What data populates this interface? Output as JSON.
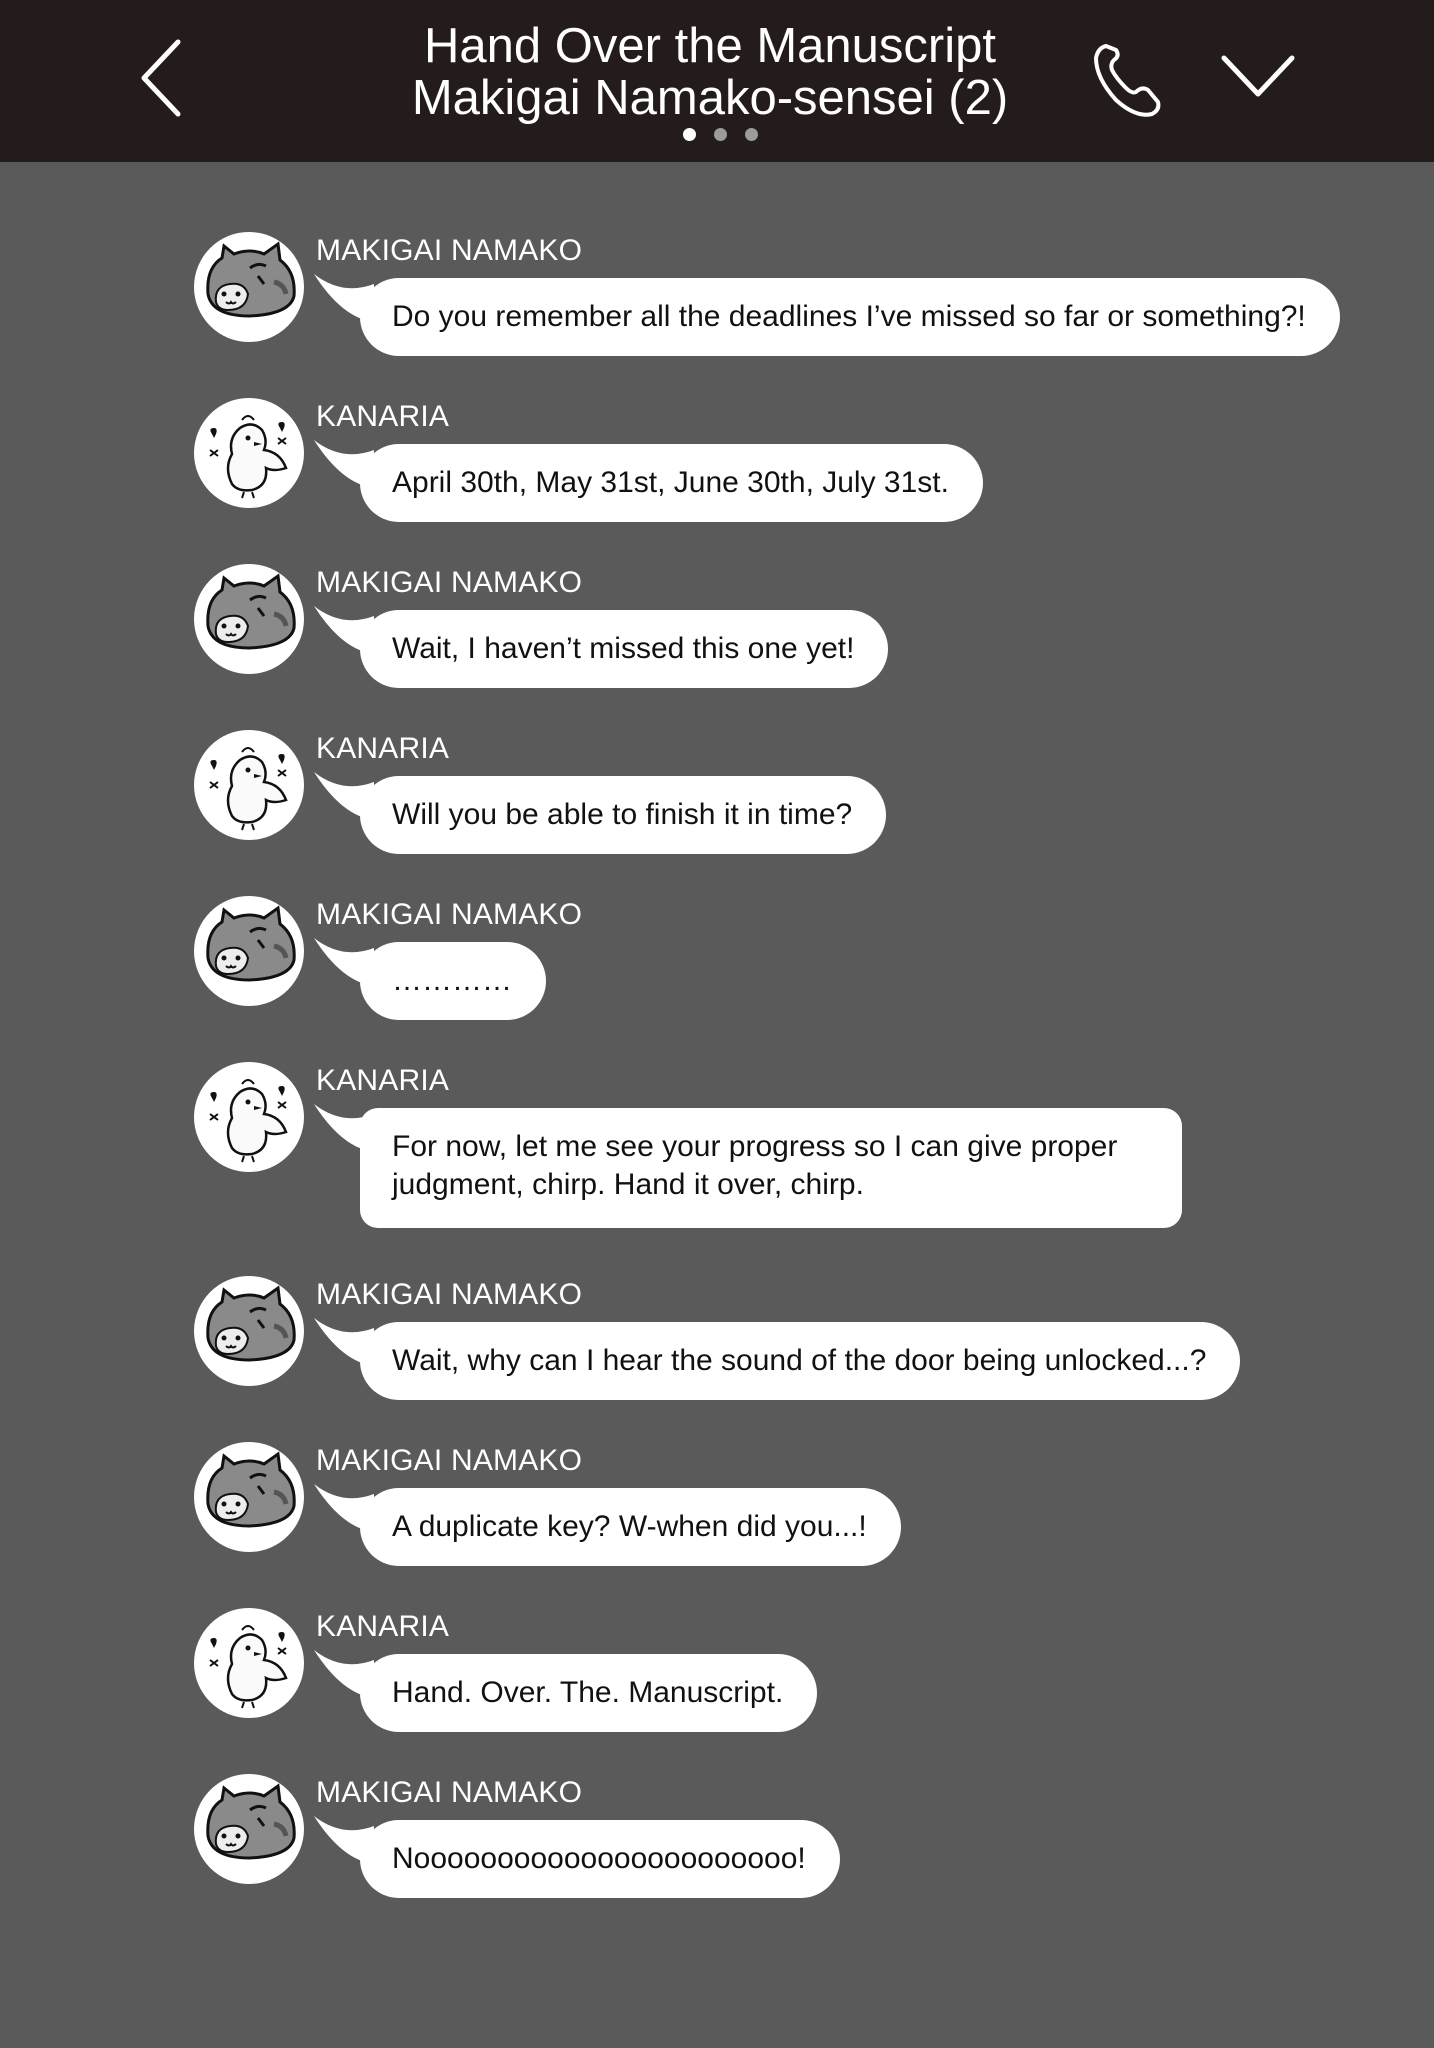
{
  "header": {
    "title_line1": "Hand Over the Manuscript",
    "title_line2": "Makigai Namako-sensei (2)",
    "page_dots": 3,
    "active_dot": 0,
    "icons": {
      "back": "chevron-left-icon",
      "call": "phone-icon",
      "menu": "chevron-down-icon"
    }
  },
  "colors": {
    "header_bg": "#231c1b",
    "chat_bg": "#5b5a5b",
    "bubble_bg": "#ffffff",
    "text_light": "#ffffff"
  },
  "messages": [
    {
      "sender": "MAKIGAI NAMAKO",
      "avatar": "cat-avatar",
      "text": "Do you remember all the deadlines I’ve missed so far or something?!"
    },
    {
      "sender": "KANARIA",
      "avatar": "bird-avatar",
      "text": "April 30th, May 31st, June 30th, July 31st."
    },
    {
      "sender": "MAKIGAI NAMAKO",
      "avatar": "cat-avatar",
      "text": "Wait, I haven’t missed this one yet!"
    },
    {
      "sender": "KANARIA",
      "avatar": "bird-avatar",
      "text": "Will you be able to finish it in time?"
    },
    {
      "sender": "MAKIGAI NAMAKO",
      "avatar": "cat-avatar",
      "text": "…………"
    },
    {
      "sender": "KANARIA",
      "avatar": "bird-avatar",
      "text": "For now, let me see your progress so I can give proper judgment, chirp. Hand it over, chirp."
    },
    {
      "sender": "MAKIGAI NAMAKO",
      "avatar": "cat-avatar",
      "text": "Wait, why can I hear the sound of the door being unlocked...?"
    },
    {
      "sender": "MAKIGAI NAMAKO",
      "avatar": "cat-avatar",
      "text": "A duplicate key? W-when did you...!"
    },
    {
      "sender": "KANARIA",
      "avatar": "bird-avatar",
      "text": "Hand. Over. The. Manuscript."
    },
    {
      "sender": "MAKIGAI NAMAKO",
      "avatar": "cat-avatar",
      "text": "Nooooooooooooooooooooooo!"
    }
  ]
}
